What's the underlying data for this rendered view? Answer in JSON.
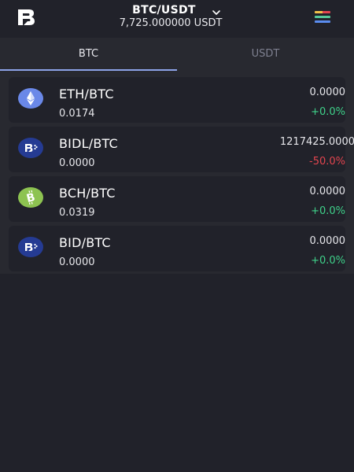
{
  "header": {
    "pair": "BTC/USDT",
    "price": "7,725.000000 USDT",
    "logo_icon": "bidesk-logo-icon",
    "dropdown_icon": "chevron-down-icon",
    "menu_icon": "menu-icon",
    "menu_colors": [
      "#f3c14a",
      "#e2454f",
      "#56c99a",
      "#5b8df0"
    ]
  },
  "tabs": [
    {
      "label": "BTC",
      "active": true
    },
    {
      "label": "USDT",
      "active": false
    }
  ],
  "colors": {
    "background": "#21222a",
    "panel": "#282930",
    "accent": "#8da3e8",
    "positive": "#3fd18a",
    "negative": "#e2454f"
  },
  "pairs": [
    {
      "name": "ETH/BTC",
      "volume": "0.0174",
      "last": "0.0000",
      "change": "+0.0%",
      "direction": "up",
      "icon": "ethereum-icon",
      "icon_color": "#6a88e8"
    },
    {
      "name": "BIDL/BTC",
      "volume": "0.0000",
      "last": "1217425.0000",
      "change": "-50.0%",
      "direction": "down",
      "icon": "bidesk-icon",
      "icon_color": "#253b93"
    },
    {
      "name": "BCH/BTC",
      "volume": "0.0319",
      "last": "0.0000",
      "change": "+0.0%",
      "direction": "up",
      "icon": "bitcoin-cash-icon",
      "icon_color": "#8dc351"
    },
    {
      "name": "BID/BTC",
      "volume": "0.0000",
      "last": "0.0000",
      "change": "+0.0%",
      "direction": "up",
      "icon": "bidesk-icon",
      "icon_color": "#253b93"
    }
  ]
}
